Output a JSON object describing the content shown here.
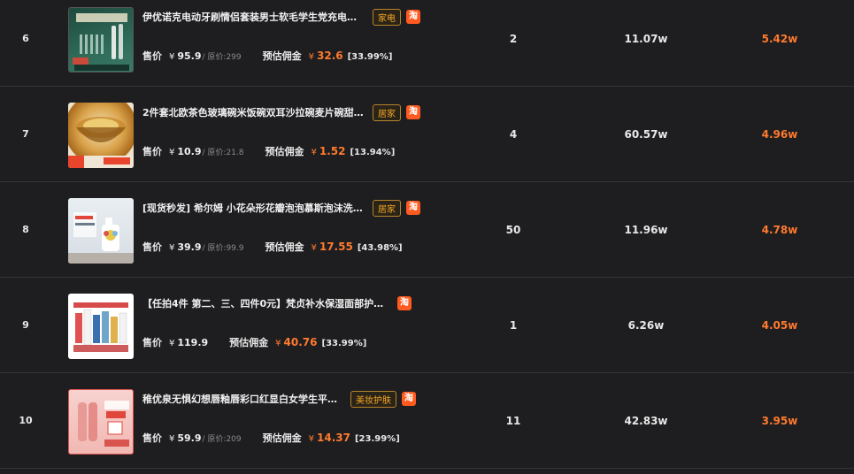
{
  "common": {
    "sale_label": "售价",
    "currency": "¥",
    "commission_label": "预估佣金",
    "platform_icon": "淘"
  },
  "rows": [
    {
      "rank": "6",
      "title": "伊优诺克电动牙刷情侣套装男士软毛学生党充电式...",
      "tag": "家电",
      "price": "95.9",
      "original_price": "/ 原价:299",
      "commission": "32.6",
      "rate": "[33.99%]",
      "count": "2",
      "sales": "11.07w",
      "amount": "5.42w"
    },
    {
      "rank": "7",
      "title": "2件套北欧茶色玻璃碗米饭碗双耳沙拉碗麦片碗甜...",
      "tag": "居家",
      "price": "10.9",
      "original_price": "/ 原价:21.8",
      "commission": "1.52",
      "rate": "[13.94%]",
      "count": "4",
      "sales": "60.57w",
      "amount": "4.96w"
    },
    {
      "rank": "8",
      "title": "[现货秒发] 希尔姆 小花朵形花瓣泡泡慕斯泡沫洗手...",
      "tag": "居家",
      "price": "39.9",
      "original_price": "/ 原价:99.9",
      "commission": "17.55",
      "rate": "[43.98%]",
      "count": "50",
      "sales": "11.96w",
      "amount": "4.78w"
    },
    {
      "rank": "9",
      "title": "【任拍4件 第二、三、四件0元】梵贞补水保湿面部护肤组...",
      "tag": "",
      "price": "119.9",
      "original_price": "",
      "commission": "40.76",
      "rate": "[33.99%]",
      "count": "1",
      "sales": "6.26w",
      "amount": "4.05w"
    },
    {
      "rank": "10",
      "title": "稚优泉无惧幻想唇釉唇彩口红显白女学生平价...",
      "tag": "美妆护肤",
      "price": "59.9",
      "original_price": "/ 原价:209",
      "commission": "14.37",
      "rate": "[23.99%]",
      "count": "11",
      "sales": "42.83w",
      "amount": "3.95w"
    }
  ]
}
